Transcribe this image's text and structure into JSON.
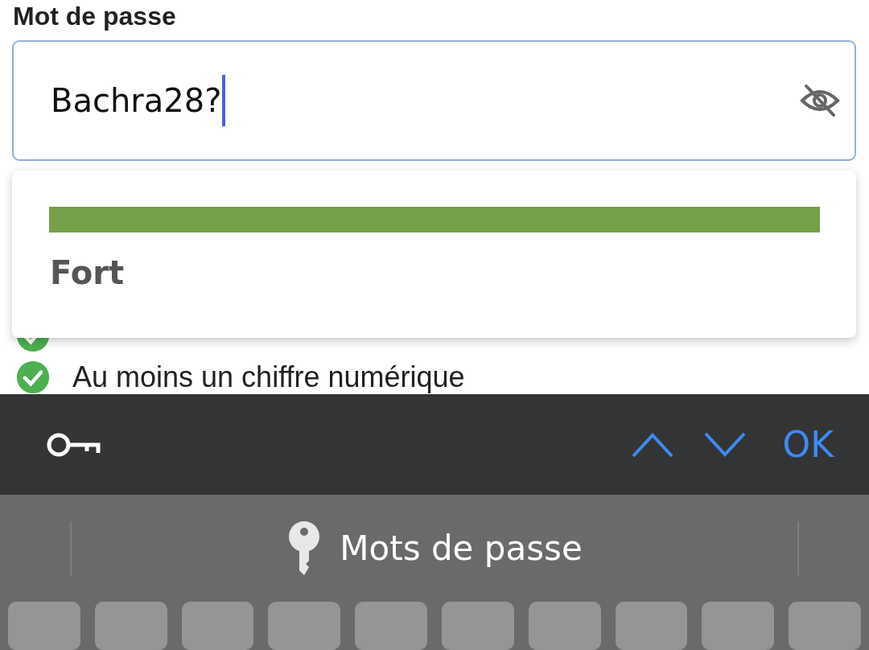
{
  "field": {
    "label": "Mot de passe",
    "value": "Bachra28?",
    "focused": true,
    "masked": false
  },
  "strength": {
    "level": 1,
    "label": "Fort"
  },
  "requirements": [
    {
      "met": true
    },
    {
      "text": "Au moins un chiffre numérique",
      "met": true
    }
  ],
  "toolbar": {
    "done": "OK"
  },
  "keyboard": {
    "suggestion": "Mots de passe"
  }
}
